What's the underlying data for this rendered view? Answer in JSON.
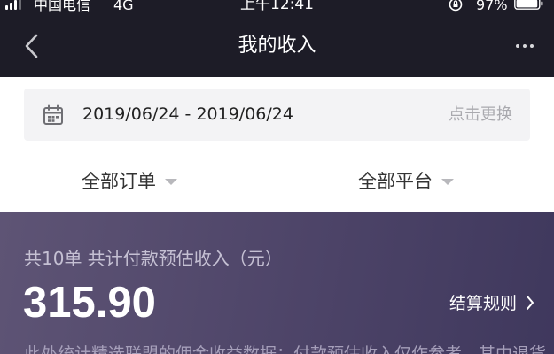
{
  "status_bar": {
    "carrier": "中国电信",
    "network": "4G",
    "time": "上午12:41",
    "battery": "97%",
    "battery_level": 0.97,
    "signal_bars": 3
  },
  "nav": {
    "title": "我的收入",
    "back_icon": "chevron-left-icon",
    "more_icon": "more-dots-icon"
  },
  "date_picker": {
    "icon": "calendar-icon",
    "range": "2019/06/24 - 2019/06/24",
    "change_label": "点击更换"
  },
  "filters": {
    "orders_label": "全部订单",
    "platforms_label": "全部平台"
  },
  "income": {
    "summary": "共10单 共计付款预估收入（元）",
    "amount": "315.90",
    "rules_label": "结算规则",
    "footnote": "此处统计精选联盟的佣金收益数据；付款预估收入仅作参考，其中退货"
  },
  "colors": {
    "header_bg": "#1d1c27",
    "card_gradient_start": "#5e5475",
    "card_gradient_end": "#3f385d",
    "date_box_bg": "#f3f3f5"
  }
}
